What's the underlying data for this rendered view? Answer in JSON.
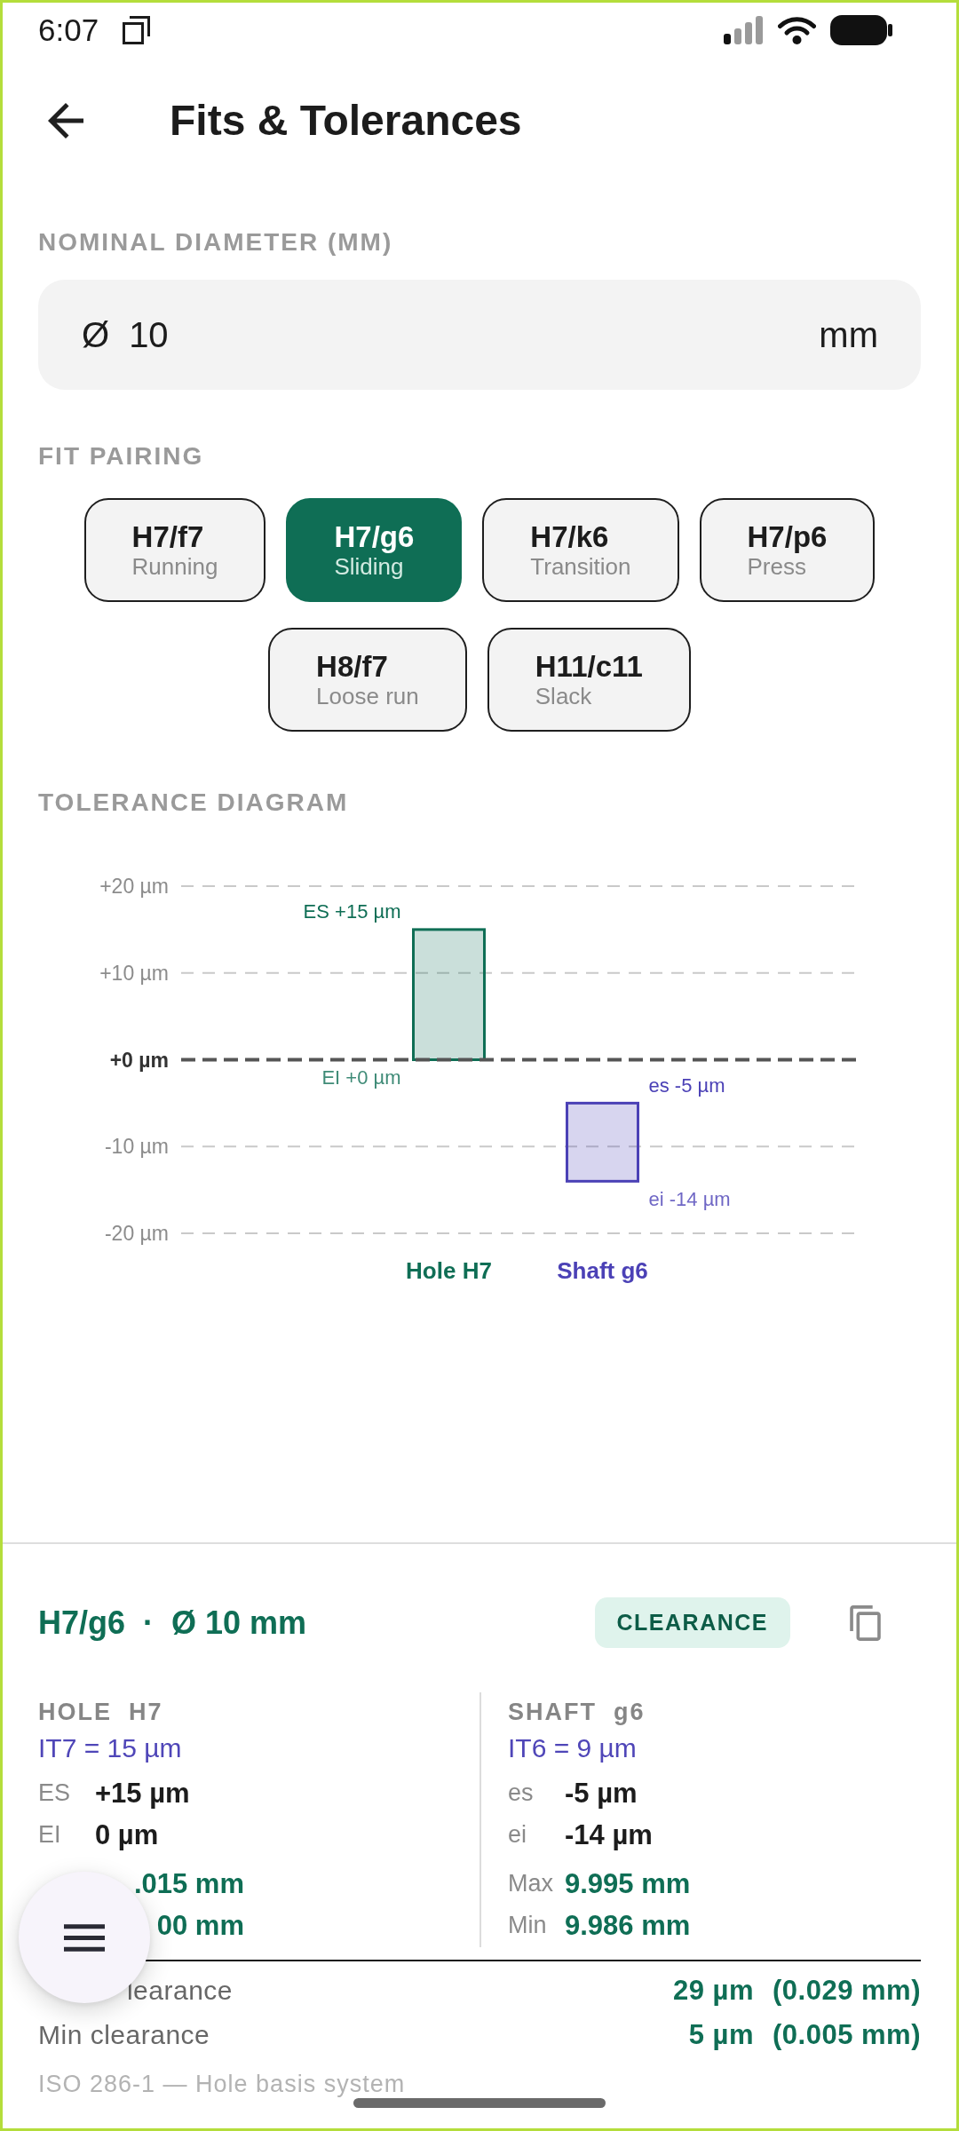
{
  "status_bar": {
    "time": "6:07"
  },
  "header": {
    "title": "Fits & Tolerances"
  },
  "nominal_diameter": {
    "label": "NOMINAL DIAMETER (MM)",
    "symbol": "Ø",
    "value": "10",
    "unit": "mm"
  },
  "fit_pairing": {
    "label": "FIT PAIRING",
    "options": [
      {
        "code": "H7/f7",
        "name": "Running",
        "selected": false
      },
      {
        "code": "H7/g6",
        "name": "Sliding",
        "selected": true
      },
      {
        "code": "H7/k6",
        "name": "Transition",
        "selected": false
      },
      {
        "code": "H7/p6",
        "name": "Press",
        "selected": false
      },
      {
        "code": "H8/f7",
        "name": "Loose run",
        "selected": false
      },
      {
        "code": "H11/c11",
        "name": "Slack",
        "selected": false
      }
    ]
  },
  "tolerance_diagram": {
    "label": "TOLERANCE DIAGRAM",
    "chart_data": {
      "type": "candlestick",
      "categories": [
        "Hole H7",
        "Shaft g6"
      ],
      "colors": [
        "#0f6e55",
        "#4b41b6"
      ],
      "ohlc": [
        [
          0,
          15,
          0,
          15
        ],
        [
          -14,
          -5,
          -14,
          -5
        ]
      ],
      "ylim": [
        -20,
        20
      ],
      "yticks": [
        {
          "value": 20,
          "label": "+20 µm"
        },
        {
          "value": 10,
          "label": "+10 µm"
        },
        {
          "value": 0,
          "label": "+0 µm"
        },
        {
          "value": -10,
          "label": "-10 µm"
        },
        {
          "value": -20,
          "label": "-20 µm"
        }
      ],
      "ref_lines": [
        {
          "axis": "y",
          "value": 0
        }
      ],
      "annotations": [
        "ES +15 µm",
        "EI +0 µm",
        "es -5 µm",
        "ei -14 µm"
      ]
    }
  },
  "result": {
    "title": "H7/g6  ·  Ø 10 mm",
    "badge": "CLEARANCE",
    "columns": [
      {
        "heading": "HOLE  H7",
        "grade": "IT7 = 15 µm",
        "rows": [
          {
            "kind": "deviation",
            "label": "ES",
            "value": "+15 µm",
            "covered": false
          },
          {
            "kind": "deviation",
            "label": "EI",
            "value": "0 µm",
            "covered": false
          },
          {
            "kind": "size",
            "value": ".015 mm",
            "covered": true
          },
          {
            "kind": "size",
            "value": "00 mm",
            "covered": true
          }
        ]
      },
      {
        "heading": "SHAFT  g6",
        "grade": "IT6 = 9 µm",
        "rows": [
          {
            "kind": "deviation",
            "label": "es",
            "value": "-5 µm",
            "covered": false
          },
          {
            "kind": "deviation",
            "label": "ei",
            "value": "-14 µm",
            "covered": false
          },
          {
            "kind": "size",
            "label": "Max",
            "value": "9.995 mm",
            "covered": false
          },
          {
            "kind": "size",
            "label": "Min",
            "value": "9.986 mm",
            "covered": false
          }
        ]
      }
    ],
    "summary": [
      {
        "label": "learance",
        "value": "29 µm",
        "value_mm": "(0.029 mm)",
        "covered": true
      },
      {
        "label": "Min clearance",
        "value": "5 µm",
        "value_mm": "(0.005 mm)",
        "covered": false
      }
    ],
    "footnote": "ISO 286-1 — Hole basis system"
  }
}
